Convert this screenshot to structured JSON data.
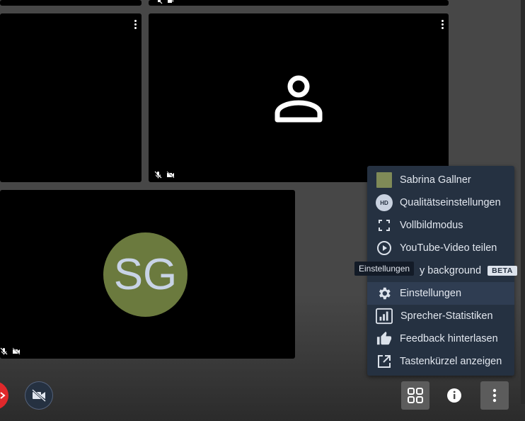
{
  "tiles": {
    "sg_avatar_initials": "SG"
  },
  "menu": {
    "items": [
      {
        "label": "Sabrina Gallner",
        "icon": "profile-swatch"
      },
      {
        "label": "Qualitätseinstellungen",
        "icon": "hd-icon",
        "icon_text": "HD"
      },
      {
        "label": "Vollbildmodus",
        "icon": "fullscreen-icon"
      },
      {
        "label": "YouTube-Video teilen",
        "icon": "play-circle-icon"
      },
      {
        "label": "y background",
        "icon": "blur-icon",
        "badge": "BETA"
      },
      {
        "label": "Einstellungen",
        "icon": "gear-icon"
      },
      {
        "label": "Sprecher-Statistiken",
        "icon": "stats-icon"
      },
      {
        "label": "Feedback hinterlasen",
        "icon": "thumbs-up-icon"
      },
      {
        "label": "Tastenkürzel anzeigen",
        "icon": "external-link-icon"
      }
    ]
  },
  "tooltip": {
    "text": "Einstellungen"
  },
  "colors": {
    "menu_bg": "#253141",
    "menu_active_bg": "#2f3d52",
    "avatar_bg": "#6b7a3e",
    "hangup_red": "#e0282b"
  }
}
